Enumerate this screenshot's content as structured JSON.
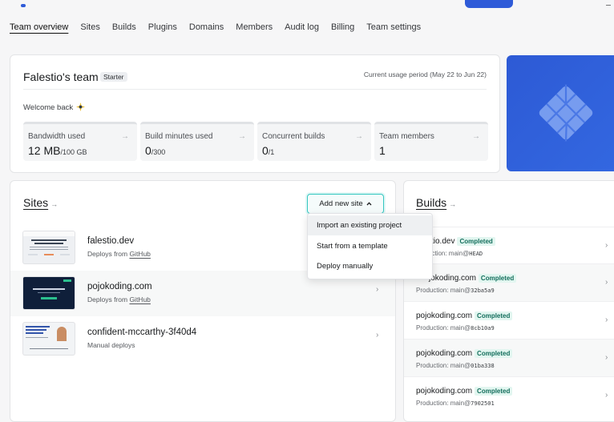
{
  "tabs": [
    "Team overview",
    "Sites",
    "Builds",
    "Plugins",
    "Domains",
    "Members",
    "Audit log",
    "Billing",
    "Team settings"
  ],
  "team": {
    "title": "Falestio's team",
    "plan": "Starter",
    "usage_period": "Current usage period (May 22 to Jun 22)",
    "welcome": "Welcome back"
  },
  "stats": [
    {
      "label": "Bandwidth used",
      "value": "12 MB",
      "limit": "/100 GB"
    },
    {
      "label": "Build minutes used",
      "value": "0",
      "limit": "/300"
    },
    {
      "label": "Concurrent builds",
      "value": "0",
      "limit": "/1"
    },
    {
      "label": "Team members",
      "value": "1",
      "limit": ""
    }
  ],
  "sites_section": {
    "title": "Sites",
    "add_button": "Add new site",
    "items": [
      {
        "name": "falestio.dev",
        "sub_prefix": "Deploys from ",
        "sub_link": "GitHub"
      },
      {
        "name": "pojokoding.com",
        "sub_prefix": "Deploys from ",
        "sub_link": "GitHub"
      },
      {
        "name": "confident-mccarthy-3f40d4",
        "sub_prefix": "Manual deploys",
        "sub_link": ""
      }
    ]
  },
  "dropdown": {
    "items": [
      "Import an existing project",
      "Start from a template",
      "Deploy manually"
    ]
  },
  "builds_section": {
    "title": "Builds",
    "items": [
      {
        "name": "tio.dev",
        "status": "Completed",
        "sub": "uction: main@",
        "ref": "HEAD"
      },
      {
        "name": "jokoding.com",
        "status": "Completed",
        "sub": "Production: main@",
        "ref": "32ba5a9"
      },
      {
        "name": "pojokoding.com",
        "status": "Completed",
        "sub": "Production: main@",
        "ref": "8cb10a9"
      },
      {
        "name": "pojokoding.com",
        "status": "Completed",
        "sub": "Production: main@",
        "ref": "01ba338"
      },
      {
        "name": "pojokoding.com",
        "status": "Completed",
        "sub": "Production: main@",
        "ref": "7902501"
      }
    ]
  },
  "colors": {
    "accent": "#2f5bd8",
    "teal": "#34c7c0",
    "badge": "#146e5c"
  }
}
